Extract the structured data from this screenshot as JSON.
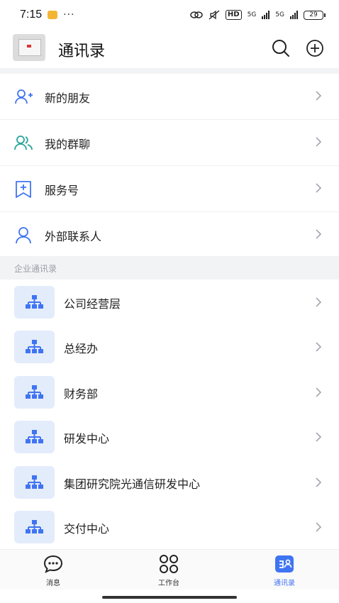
{
  "status_bar": {
    "time": "7:15",
    "dots": "···",
    "network_label": "HD",
    "signal1_label": "5G",
    "signal2_label": "5G",
    "battery": "29"
  },
  "header": {
    "title": "通讯录"
  },
  "quick_entries": [
    {
      "label": "新的朋友",
      "icon": "add-friend-icon"
    },
    {
      "label": "我的群聊",
      "icon": "group-chat-icon"
    },
    {
      "label": "服务号",
      "icon": "service-account-icon"
    },
    {
      "label": "外部联系人",
      "icon": "external-contact-icon"
    }
  ],
  "section_title": "企业通讯录",
  "departments": [
    {
      "label": "公司经营层",
      "icon": "org-chart-icon"
    },
    {
      "label": "总经办",
      "icon": "org-chart-icon"
    },
    {
      "label": "财务部",
      "icon": "org-chart-icon"
    },
    {
      "label": "研发中心",
      "icon": "org-chart-icon"
    },
    {
      "label": "集团研究院光通信研发中心",
      "icon": "org-chart-icon"
    },
    {
      "label": "交付中心",
      "icon": "org-chart-icon"
    }
  ],
  "tabs": [
    {
      "label": "消息",
      "icon": "message-icon",
      "active": false
    },
    {
      "label": "工作台",
      "icon": "workbench-icon",
      "active": false
    },
    {
      "label": "通讯录",
      "icon": "contacts-icon",
      "active": true
    }
  ],
  "colors": {
    "accent": "#3f74f2",
    "org_icon": "#3f74f2",
    "org_icon_bg": "#e3ecfb",
    "group_icon": "#27a39a",
    "section_bg": "#f2f3f5"
  }
}
